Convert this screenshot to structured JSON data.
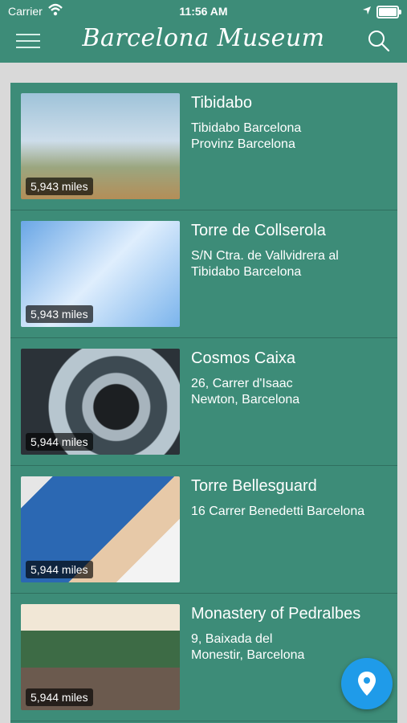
{
  "status": {
    "carrier": "Carrier",
    "time": "11:56 AM",
    "wifi_icon": "wifi-icon",
    "location_icon": "location-arrow-icon",
    "battery_icon": "battery-icon"
  },
  "header": {
    "title": "Barcelona Museum",
    "menu_icon": "hamburger-menu-icon",
    "search_icon": "search-icon"
  },
  "museums": [
    {
      "name": "Tibidabo",
      "address": "Tibidabo Barcelona\nProvinz Barcelona",
      "distance": "5,943 miles"
    },
    {
      "name": "Torre de Collserola",
      "address": "S/N Ctra. de Vallvidrera al\nTibidabo Barcelona",
      "distance": "5,943 miles"
    },
    {
      "name": "Cosmos Caixa",
      "address": "26, Carrer d'Isaac\nNewton, Barcelona",
      "distance": "5,944 miles"
    },
    {
      "name": "Torre Bellesguard",
      "address": "16 Carrer Benedetti Barcelona",
      "distance": "5,944 miles"
    },
    {
      "name": "Monastery of Pedralbes",
      "address": "9, Baixada del\nMonestir, Barcelona",
      "distance": "5,944 miles"
    }
  ],
  "map_button_icon": "map-pin-icon",
  "colors": {
    "primary": "#3d8c78",
    "accent": "#1f9be9",
    "background": "#d9d9d9"
  }
}
